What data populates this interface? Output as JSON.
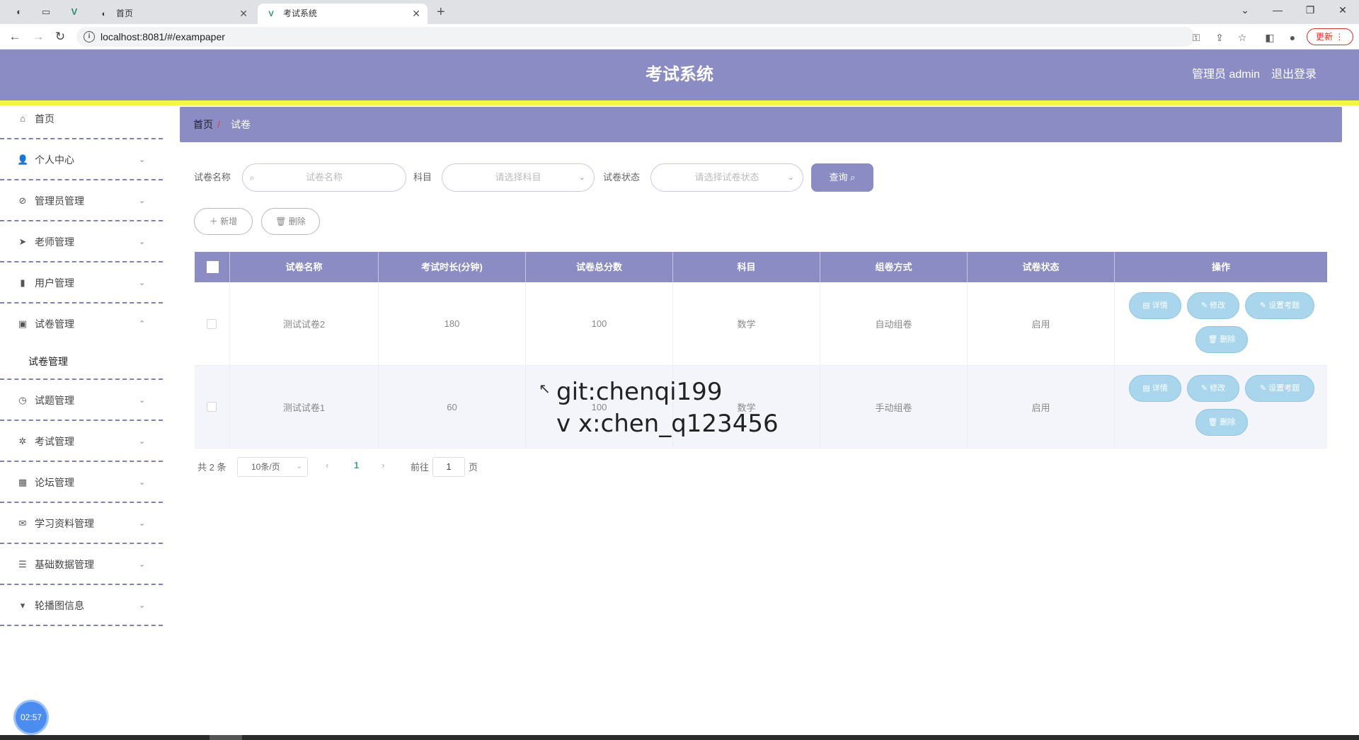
{
  "browser": {
    "tabs": [
      {
        "title": "首页",
        "close": "✕"
      },
      {
        "title": "考试系统",
        "close": "✕"
      }
    ],
    "new_tab": "+",
    "url": "localhost:8081/#/exampaper",
    "update_label": "更新",
    "window_controls": [
      "⌄",
      "—",
      "❐",
      "✕"
    ]
  },
  "header": {
    "title": "考试系统",
    "user": "管理员 admin",
    "logout": "退出登录",
    "colors": {
      "primary": "#8a8cc3",
      "accent_bar": "#f5f542"
    }
  },
  "sidebar": {
    "items": [
      {
        "label": "首页",
        "icon": "home-icon",
        "glyph": "⌂"
      },
      {
        "label": "个人中心",
        "icon": "user-icon",
        "glyph": "👤"
      },
      {
        "label": "管理员管理",
        "icon": "compass-icon",
        "glyph": "⊘"
      },
      {
        "label": "老师管理",
        "icon": "send-icon",
        "glyph": "➤"
      },
      {
        "label": "用户管理",
        "icon": "chart-icon",
        "glyph": "▮"
      },
      {
        "label": "试卷管理",
        "icon": "clipboard-icon",
        "glyph": "▣"
      },
      {
        "label": "试题管理",
        "icon": "clock-icon",
        "glyph": "◷"
      },
      {
        "label": "考试管理",
        "icon": "aperture-icon",
        "glyph": "✲"
      },
      {
        "label": "论坛管理",
        "icon": "grid-icon",
        "glyph": "▦"
      },
      {
        "label": "学习资料管理",
        "icon": "mail-icon",
        "glyph": "✉"
      },
      {
        "label": "基础数据管理",
        "icon": "sliders-icon",
        "glyph": "☰"
      },
      {
        "label": "轮播图信息",
        "icon": "brush-icon",
        "glyph": "▾"
      }
    ],
    "sub_item": "试卷管理",
    "clock": "02:57"
  },
  "breadcrumb": {
    "home": "首页",
    "sep": "/",
    "current": "试卷"
  },
  "search": {
    "name_label": "试卷名称",
    "name_placeholder": "试卷名称",
    "subject_label": "科目",
    "subject_placeholder": "请选择科目",
    "status_label": "试卷状态",
    "status_placeholder": "请选择试卷状态",
    "query_label": "查询 ⌕"
  },
  "actions": {
    "add": "＋ 新增",
    "delete": "🗑 删除"
  },
  "table": {
    "headers": [
      "试卷名称",
      "考试时长(分钟)",
      "试卷总分数",
      "科目",
      "组卷方式",
      "试卷状态",
      "操作"
    ],
    "rows": [
      {
        "name": "测试试卷2",
        "duration": "180",
        "score": "100",
        "subject": "数学",
        "method": "自动组卷",
        "status": "启用"
      },
      {
        "name": "测试试卷1",
        "duration": "60",
        "score": "100",
        "subject": "数学",
        "method": "手动组卷",
        "status": "启用"
      }
    ],
    "ops": {
      "detail": "▤ 详情",
      "edit": "✎ 修改",
      "set_questions": "✎ 设置考题",
      "delete": "🗑 删除"
    }
  },
  "watermark": {
    "line1": "git:chenqi199",
    "line2": "v x:chen_q123456"
  },
  "pagination": {
    "total": "共 2 条",
    "page_size": "10条/页",
    "prev": "‹",
    "current": "1",
    "next": "›",
    "goto_label": "前往",
    "goto_value": "1",
    "unit": "页"
  }
}
